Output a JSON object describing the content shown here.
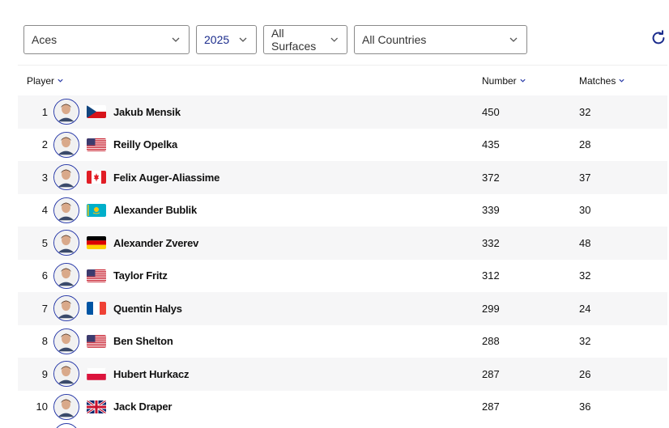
{
  "filters": {
    "stat": "Aces",
    "year": "2025",
    "surface": "All Surfaces",
    "country": "All Countries"
  },
  "table": {
    "headers": {
      "player": "Player",
      "number": "Number",
      "matches": "Matches"
    },
    "rows": [
      {
        "rank": "1",
        "name": "Jakub Mensik",
        "flag": "czech-republic",
        "number": "450",
        "matches": "32"
      },
      {
        "rank": "2",
        "name": "Reilly Opelka",
        "flag": "usa",
        "number": "435",
        "matches": "28"
      },
      {
        "rank": "3",
        "name": "Felix Auger-Aliassime",
        "flag": "canada",
        "number": "372",
        "matches": "37"
      },
      {
        "rank": "4",
        "name": "Alexander Bublik",
        "flag": "kazakhstan",
        "number": "339",
        "matches": "30"
      },
      {
        "rank": "5",
        "name": "Alexander Zverev",
        "flag": "germany",
        "number": "332",
        "matches": "48"
      },
      {
        "rank": "6",
        "name": "Taylor Fritz",
        "flag": "usa",
        "number": "312",
        "matches": "32"
      },
      {
        "rank": "7",
        "name": "Quentin Halys",
        "flag": "france",
        "number": "299",
        "matches": "24"
      },
      {
        "rank": "8",
        "name": "Ben Shelton",
        "flag": "usa",
        "number": "288",
        "matches": "32"
      },
      {
        "rank": "9",
        "name": "Hubert Hurkacz",
        "flag": "poland",
        "number": "287",
        "matches": "26"
      },
      {
        "rank": "10",
        "name": "Jack Draper",
        "flag": "united-kingdom",
        "number": "287",
        "matches": "36"
      }
    ]
  },
  "icons": {
    "refresh": "refresh-icon",
    "dropdown": "chevron-down-icon"
  },
  "colors": {
    "accent": "#2a3ba8",
    "row_alt": "#f6f6f7",
    "border": "#8a8a8a"
  }
}
